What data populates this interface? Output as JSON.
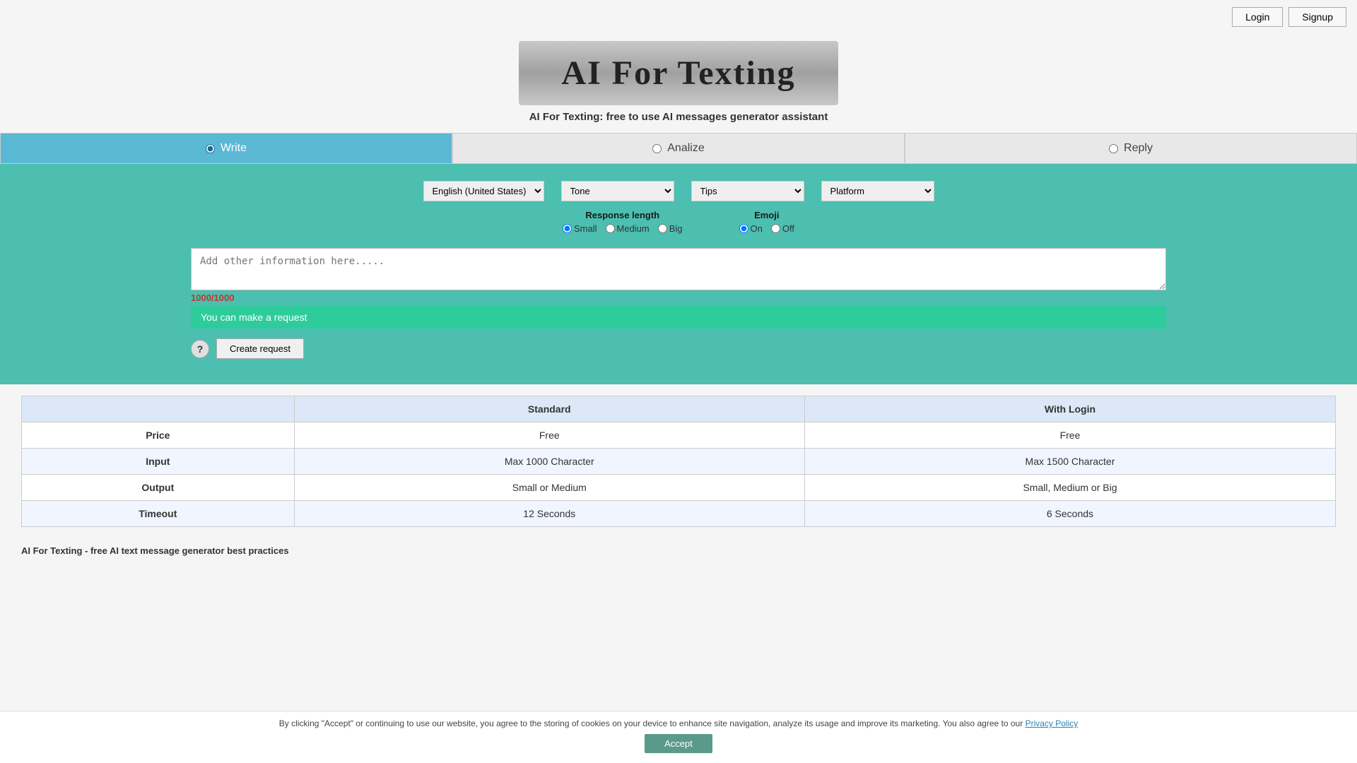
{
  "header": {
    "login_label": "Login",
    "signup_label": "Signup"
  },
  "logo": {
    "title": "AI For Texting",
    "subtitle": "AI For Texting: free to use AI messages generator assistant"
  },
  "tabs": [
    {
      "id": "write",
      "label": "Write",
      "active": true
    },
    {
      "id": "analize",
      "label": "Analize",
      "active": false
    },
    {
      "id": "reply",
      "label": "Reply",
      "active": false
    }
  ],
  "controls": {
    "language_default": "English (United States)",
    "tone_default": "Tone",
    "category_default": "Tips",
    "platform_default": "Platform",
    "response_length_label": "Response length",
    "response_length_options": [
      "Small",
      "Medium",
      "Big"
    ],
    "emoji_label": "Emoji",
    "emoji_options": [
      "On",
      "Off"
    ]
  },
  "textarea": {
    "placeholder": "Add other information here.....",
    "char_count": "1000/1000"
  },
  "status_bar": {
    "message": "You can make a request"
  },
  "actions": {
    "help_icon": "?",
    "create_request_label": "Create request"
  },
  "table": {
    "col_feature": "",
    "col_standard": "Standard",
    "col_with_login": "With Login",
    "rows": [
      {
        "feature": "Price",
        "standard": "Free",
        "with_login": "Free"
      },
      {
        "feature": "Input",
        "standard": "Max 1000 Character",
        "with_login": "Max 1500 Character"
      },
      {
        "feature": "Output",
        "standard": "Small or Medium",
        "with_login": "Small, Medium or Big"
      },
      {
        "feature": "Timeout",
        "standard": "12 Seconds",
        "with_login": "6 Seconds"
      }
    ]
  },
  "best_practices": {
    "text": "AI For Texting - free AI text message generator best practices"
  },
  "cookie": {
    "text": "By clicking \"Accept\" or continuing to use our website, you agree to the storing of cookies on your device to enhance site navigation, analyze its usage and improve its marketing. You also agree to our ",
    "link_text": "Privacy Policy",
    "accept_label": "Accept"
  }
}
